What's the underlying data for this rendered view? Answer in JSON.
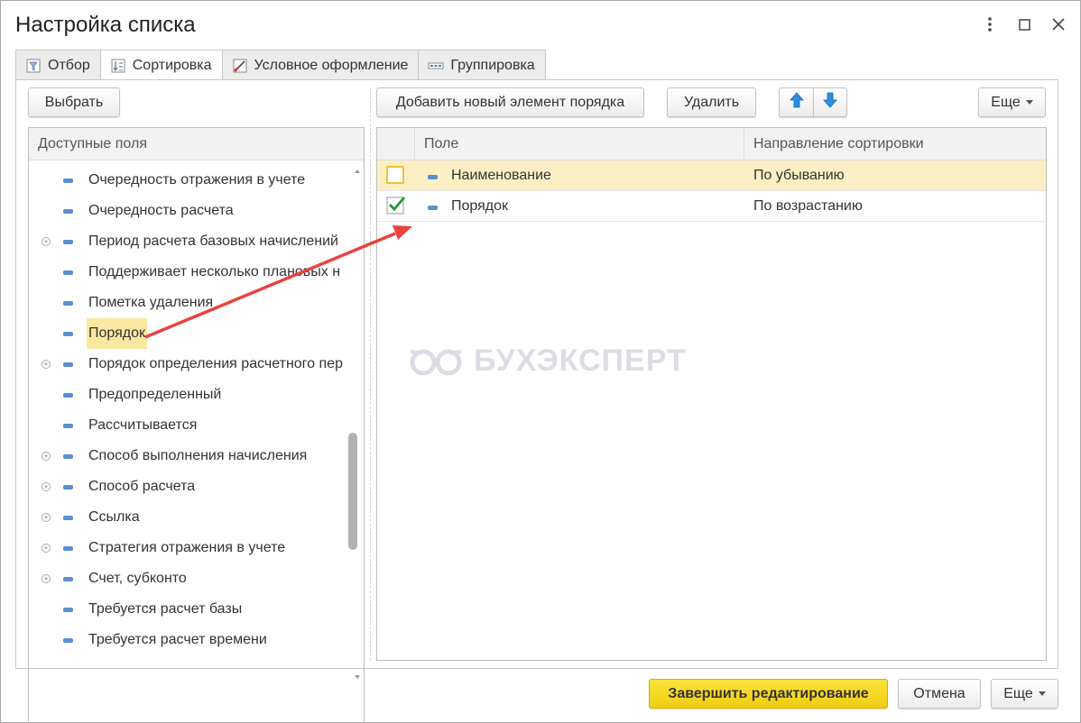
{
  "window": {
    "title": "Настройка списка"
  },
  "tabs": [
    {
      "label": "Отбор",
      "icon": "filter-icon"
    },
    {
      "label": "Сортировка",
      "icon": "sort-icon"
    },
    {
      "label": "Условное оформление",
      "icon": "conditional-format-icon"
    },
    {
      "label": "Группировка",
      "icon": "grouping-icon"
    }
  ],
  "left": {
    "select_button": "Выбрать",
    "tree_header": "Доступные поля",
    "items": [
      {
        "label": "Очередность отражения в учете",
        "expandable": false
      },
      {
        "label": "Очередность расчета",
        "expandable": false
      },
      {
        "label": "Период расчета базовых начислений",
        "expandable": true
      },
      {
        "label": "Поддерживает несколько плановых н",
        "expandable": false
      },
      {
        "label": "Пометка удаления",
        "expandable": false
      },
      {
        "label": "Порядок",
        "expandable": false,
        "highlighted": true
      },
      {
        "label": "Порядок определения расчетного пер",
        "expandable": true
      },
      {
        "label": "Предопределенный",
        "expandable": false
      },
      {
        "label": "Рассчитывается",
        "expandable": false
      },
      {
        "label": "Способ выполнения начисления",
        "expandable": true
      },
      {
        "label": "Способ расчета",
        "expandable": true
      },
      {
        "label": "Ссылка",
        "expandable": true
      },
      {
        "label": "Стратегия отражения в учете",
        "expandable": true
      },
      {
        "label": "Счет, субконто",
        "expandable": true
      },
      {
        "label": "Требуется расчет базы",
        "expandable": false
      },
      {
        "label": "Требуется расчет времени",
        "expandable": false
      }
    ]
  },
  "right": {
    "add_button": "Добавить новый элемент порядка",
    "delete_button": "Удалить",
    "more_button": "Еще",
    "columns": {
      "field": "Поле",
      "direction": "Направление сортировки"
    },
    "rows": [
      {
        "field": "Наименование",
        "direction": "По убыванию",
        "checked": false,
        "selected": true
      },
      {
        "field": "Порядок",
        "direction": "По возрастанию",
        "checked": true,
        "selected": false
      }
    ]
  },
  "footer": {
    "finish_button": "Завершить редактирование",
    "cancel_button": "Отмена",
    "more_button": "Еще"
  },
  "watermark": "БУХЭКСПЕРТ",
  "colors": {
    "accent_yellow": "#f5d320",
    "highlight": "#fbe8a0",
    "selected_row": "#fcefc3",
    "arrow": "#e8433f",
    "arrow_button": "#2d8ee0",
    "check": "#1f9a3a"
  }
}
